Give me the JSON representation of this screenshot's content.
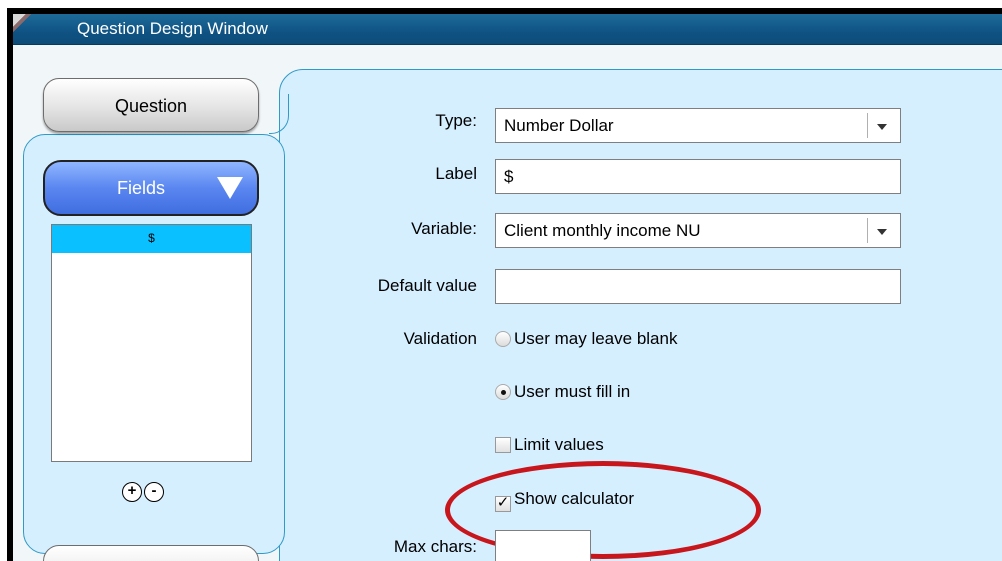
{
  "window": {
    "title": "Question Design Window"
  },
  "sidebar": {
    "question_tab": "Question",
    "fields_tab": "Fields",
    "list_items": [
      "$"
    ],
    "add_symbol": "+",
    "remove_symbol": "-"
  },
  "form": {
    "type_label": "Type:",
    "type_value": "Number Dollar",
    "label_label": "Label",
    "label_value": "$",
    "variable_label": "Variable:",
    "variable_value": "Client monthly income NU",
    "default_label": "Default value",
    "default_value": "",
    "validation_label": "Validation",
    "validation_options": [
      "User may leave blank",
      "User must fill in"
    ],
    "validation_selected": 1,
    "limit_values_label": "Limit values",
    "limit_values_checked": false,
    "show_calculator_label": "Show calculator",
    "show_calculator_checked": true,
    "max_chars_label": "Max chars:"
  },
  "colors": {
    "titlebar": "#0f5383",
    "panel": "#d6efff",
    "panel_border": "#2e9ac9",
    "selection": "#0ac0ff",
    "highlight_ellipse": "#c8161d"
  }
}
